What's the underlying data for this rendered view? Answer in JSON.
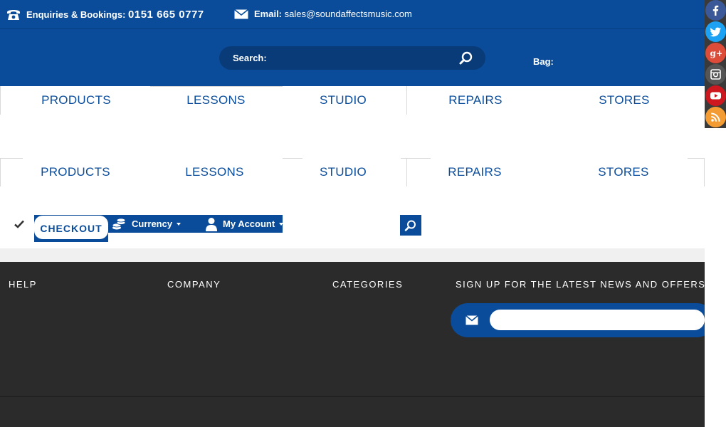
{
  "topbar": {
    "phone_label": "Enquiries & Bookings:",
    "phone_number": "0151 665 0777",
    "email_label": "Email:",
    "email_value": "sales@soundaffectsmusic.com"
  },
  "header": {
    "search_label": "Search:",
    "search_placeholder": "",
    "bag_label": "Bag:"
  },
  "nav_primary": [
    "PRODUCTS",
    "LESSONS",
    "STUDIO",
    "REPAIRS",
    "STORES"
  ],
  "nav_secondary": [
    "PRODUCTS",
    "LESSONS",
    "STUDIO",
    "REPAIRS",
    "STORES"
  ],
  "toolbar": {
    "checkout_label": "CHECKOUT",
    "currency_label": "Currency",
    "account_label": "My Account"
  },
  "footer": {
    "help_heading": "HELP",
    "company_heading": "COMPANY",
    "categories_heading": "CATEGORIES",
    "signup_heading": "SIGN UP FOR THE LATEST NEWS AND OFFERS",
    "signup_placeholder": ""
  },
  "social": [
    {
      "icon": "facebook-icon",
      "color": "#3b5998"
    },
    {
      "icon": "twitter-icon",
      "color": "#1da1f2"
    },
    {
      "icon": "google-plus-icon",
      "color": "#dd4b39"
    },
    {
      "icon": "instagram-icon",
      "color": "#555555"
    },
    {
      "icon": "youtube-icon",
      "color": "#cc181e"
    },
    {
      "icon": "rss-icon",
      "color": "#f39c34"
    }
  ],
  "colors": {
    "brand_blue": "#0a4c9a",
    "footer_bg": "#2b2b2b"
  }
}
